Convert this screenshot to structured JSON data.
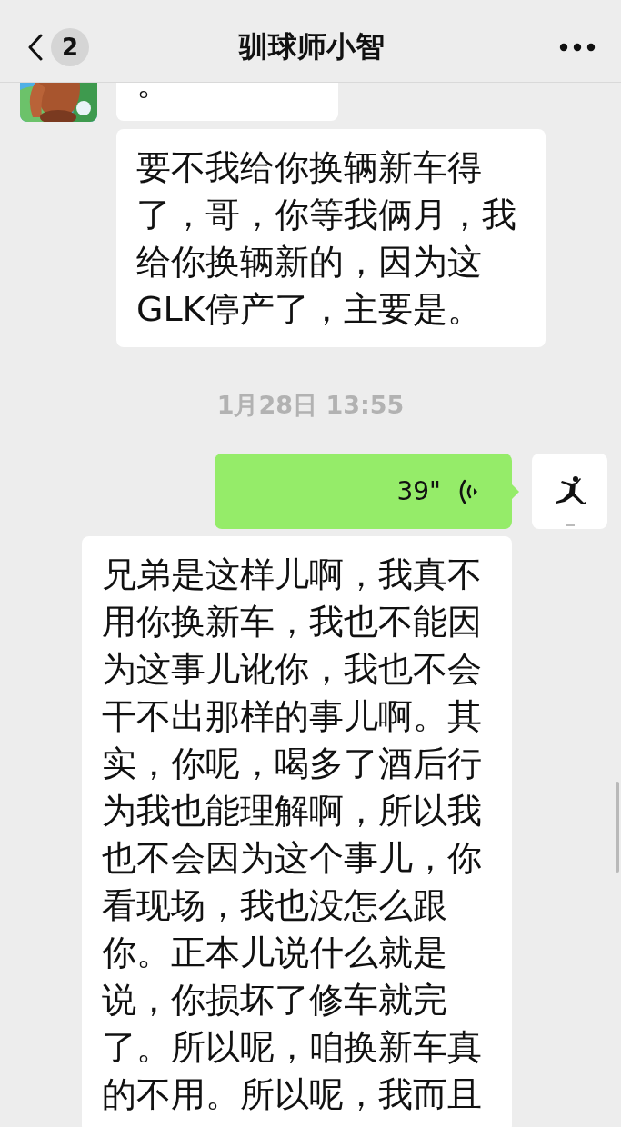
{
  "header": {
    "unread_count": "2",
    "title": "驯球师小智"
  },
  "messages": [
    {
      "kind": "received",
      "avatar": true,
      "text": "。"
    },
    {
      "kind": "received",
      "avatar": false,
      "text": "要不我给你换辆新车得了，哥，你等我俩月，我给你换辆新的，因为这GLK停产了，主要是。"
    },
    {
      "kind": "time",
      "text": "1月28日 13:55"
    },
    {
      "kind": "sent_voice",
      "avatar": true,
      "duration": "39\""
    },
    {
      "kind": "sent_text",
      "avatar": false,
      "text": "兄弟是这样儿啊，我真不用你换新车，我也不能因为这事儿讹你，我也不会干不出那样的事儿啊。其实，你呢，喝多了酒后行为我也能理解啊，所以我也不会因为这个事儿，你看现场，我也没怎么跟你。正本儿说什么就是说，你损坏了修车就完了。所以呢，咱换新车真的不用。所以呢，我而且"
    }
  ]
}
